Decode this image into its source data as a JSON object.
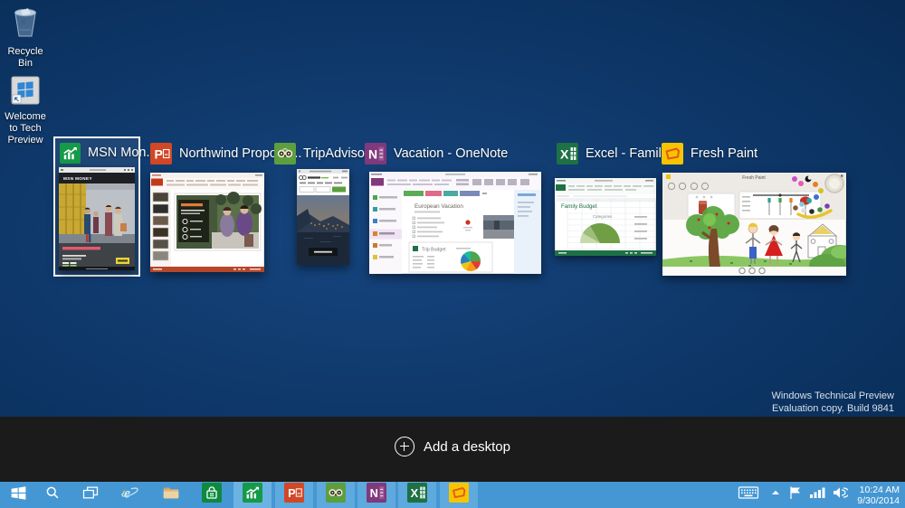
{
  "desktop": {
    "icons": [
      {
        "label": "Recycle Bin"
      },
      {
        "label": "Welcome to Tech Preview"
      }
    ],
    "watermark_line1": "Windows Technical Preview",
    "watermark_line2": "Evaluation copy. Build 9841"
  },
  "task_view": {
    "windows": [
      {
        "title": "MSN Mon...",
        "app": "msn-money",
        "selected": true
      },
      {
        "title": "Northwind Proposa...",
        "app": "powerpoint",
        "selected": false
      },
      {
        "title": "TripAdvisor...",
        "app": "tripadvisor",
        "selected": false
      },
      {
        "title": "Vacation - OneNote",
        "app": "onenote",
        "selected": false
      },
      {
        "title": "Excel - Family...",
        "app": "excel",
        "selected": false
      },
      {
        "title": "Fresh Paint",
        "app": "fresh-paint",
        "selected": false
      }
    ],
    "add_desktop_label": "Add a desktop"
  },
  "thumbnails": {
    "msn_header": "MSN MONEY",
    "onenote_page_title": "European Vacation",
    "onenote_budget_title": "Trip Budget",
    "excel_title": "Family Budget",
    "excel_chart_label": "Categories",
    "freshpaint_title": "Fresh Paint"
  },
  "app_glyphs": {
    "powerpoint": "P",
    "onenote": "N",
    "excel": "X",
    "ie": "e"
  },
  "taskbar": {
    "buttons": [
      "start",
      "search",
      "task-view",
      "internet-explorer",
      "file-explorer",
      "store",
      "msn-money",
      "powerpoint",
      "tripadvisor",
      "onenote",
      "excel",
      "fresh-paint"
    ],
    "tray_icons": [
      "touch-keyboard",
      "show-hidden-icons",
      "action-center",
      "network",
      "volume"
    ],
    "tray_time": "10:24 AM",
    "tray_date": "9/30/2014"
  },
  "colors": {
    "taskbar_blue": "#4597d3",
    "taskbar_button_running": "#5ea9dd",
    "band_dark": "#1b1b1b",
    "selection_border": "#ffffff",
    "msn_green": "#159a49",
    "powerpoint_orange": "#D24726",
    "tripadvisor_green": "#5d9e3f",
    "onenote_purple": "#80397B",
    "excel_green": "#1E7145",
    "freshpaint_yellow": "#f7c500"
  }
}
